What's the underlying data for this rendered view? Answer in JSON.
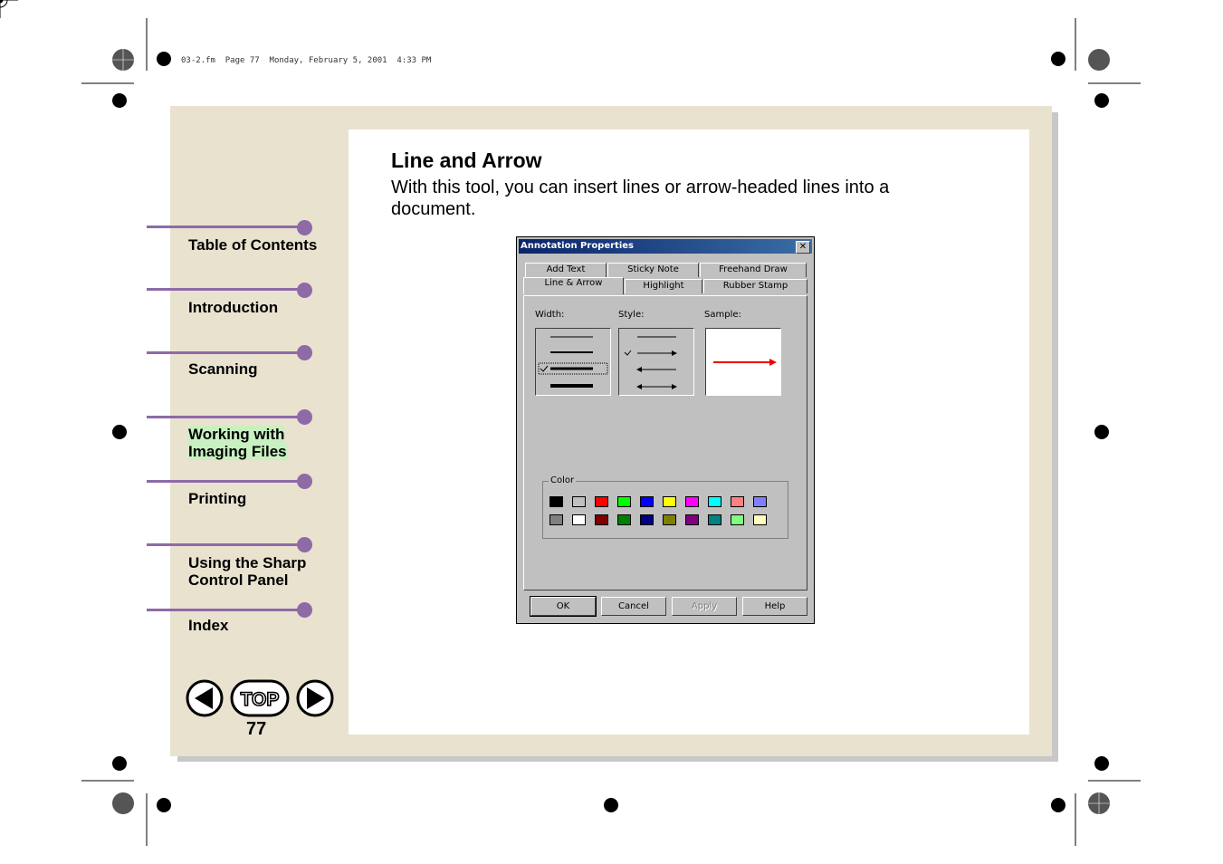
{
  "print_header": "03-2.fm  Page 77  Monday, February 5, 2001  4:33 PM",
  "section": {
    "title": "Line and Arrow",
    "body": "With this tool, you can insert lines or arrow-headed lines into a document."
  },
  "nav": {
    "items": [
      {
        "label": "Table of Contents"
      },
      {
        "label": "Introduction"
      },
      {
        "label": "Scanning"
      },
      {
        "label_line1": "Working with",
        "label_line2": "Imaging Files"
      },
      {
        "label": "Printing"
      },
      {
        "label_line1": "Using the Sharp",
        "label_line2": "Control Panel"
      },
      {
        "label": "Index"
      }
    ],
    "prev_icon": "left-arrow-icon",
    "top_label": "TOP",
    "next_icon": "right-arrow-icon",
    "page_number": "77"
  },
  "dialog": {
    "title": "Annotation Properties",
    "close_icon": "close-icon",
    "tabs_row1": [
      "Add Text",
      "Sticky Note",
      "Freehand Draw"
    ],
    "tabs_row2": [
      "Line & Arrow",
      "Highlight",
      "Rubber Stamp"
    ],
    "active_tab": "Line & Arrow",
    "width_label": "Width:",
    "style_label": "Style:",
    "sample_label": "Sample:",
    "color_label": "Color",
    "selected_width_index": 2,
    "selected_style_index": 1,
    "sample_color": "#ee0000",
    "colors_row1": [
      "#000000",
      "#c0c0c0",
      "#ff0000",
      "#00ff00",
      "#0000ff",
      "#ffff00",
      "#ff00ff",
      "#00ffff",
      "#ff8080",
      "#8080ff"
    ],
    "colors_row2": [
      "#808080",
      "#ffffff",
      "#800000",
      "#008000",
      "#000080",
      "#808000",
      "#800080",
      "#008080",
      "#80ff80",
      "#ffffc0"
    ],
    "buttons": {
      "ok": "OK",
      "cancel": "Cancel",
      "apply": "Apply",
      "help": "Help"
    }
  }
}
